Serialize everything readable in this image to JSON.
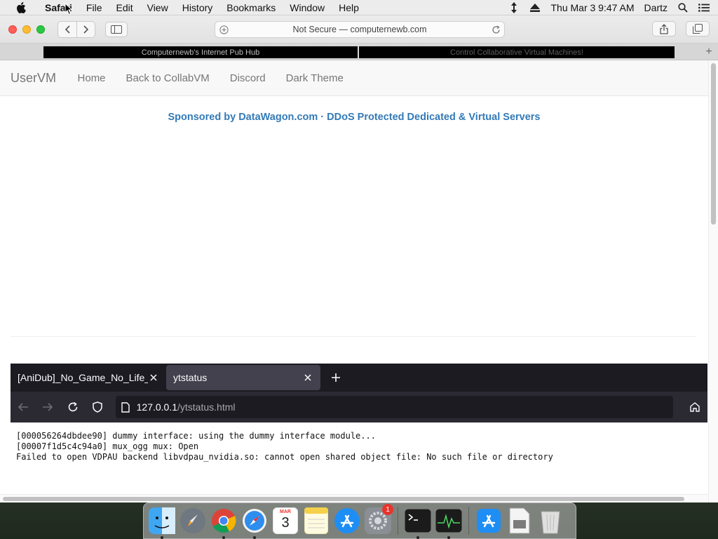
{
  "menubar": {
    "app_name": "Safari",
    "items": [
      "File",
      "Edit",
      "View",
      "History",
      "Bookmarks",
      "Window",
      "Help"
    ],
    "clock": "Thu Mar 3  9:47 AM",
    "user": "Dartz"
  },
  "safari": {
    "address": "Not Secure — computernewb.com",
    "favorites": [
      "Computernewb's Internet Pub Hub",
      "Control Collaborative Virtual Machines!"
    ]
  },
  "site": {
    "brand": "UserVM",
    "nav": [
      "Home",
      "Back to CollabVM",
      "Discord",
      "Dark Theme"
    ],
    "sponsor": "Sponsored by DataWagon.com · DDoS Protected Dedicated & Virtual Servers",
    "colors": {
      "link": "#337ab7"
    }
  },
  "vm": {
    "tabs": [
      {
        "label": "[AniDub]_No_Game_No_Life_"
      },
      {
        "label": "ytstatus"
      }
    ],
    "url_host": "127.0.0.1",
    "url_path": "/ytstatus.html",
    "log_lines": [
      "[000056264dbdee90] dummy interface: using the dummy interface module...",
      "[00007f1d5c4c94a0] mux_ogg mux: Open",
      "Failed to open VDPAU backend libvdpau_nvidia.so: cannot open shared object file: No such file or directory"
    ]
  },
  "dock": {
    "items": [
      "finder-icon",
      "launchpad-icon",
      "chrome-icon",
      "safari-icon",
      "calendar-icon",
      "notes-icon",
      "app-store-icon",
      "system-preferences-icon",
      "terminal-icon",
      "activity-monitor-icon",
      "app-store-downloads-icon",
      "file-icon",
      "trash-icon"
    ],
    "calendar_month": "MAR",
    "calendar_day": "3",
    "settings_badge": "1"
  }
}
